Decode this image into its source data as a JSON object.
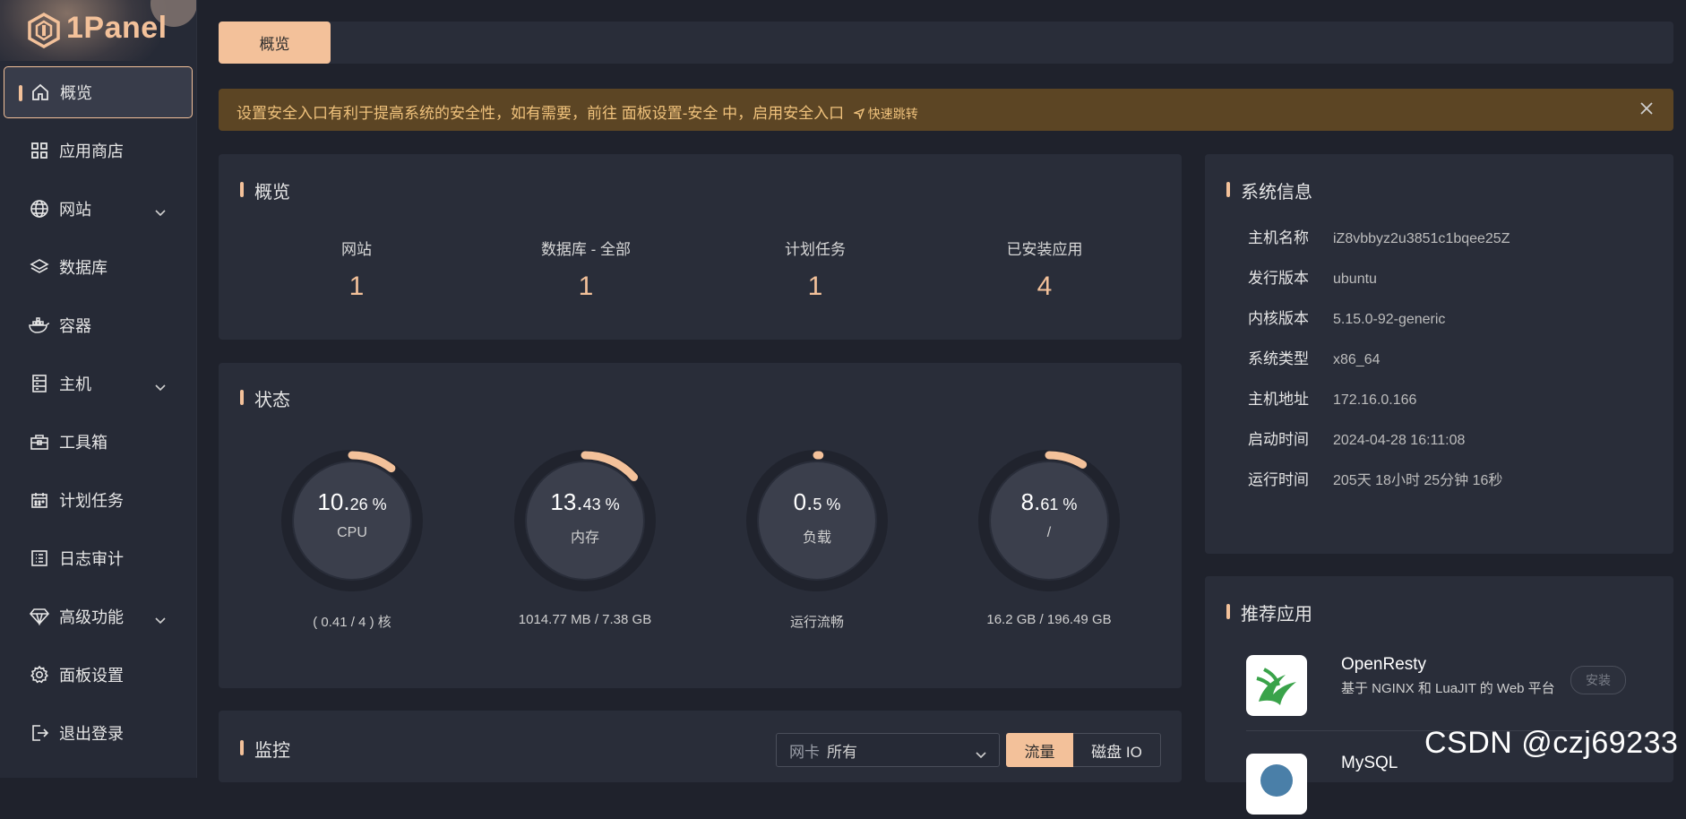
{
  "app": {
    "name": "1Panel"
  },
  "sidebar": {
    "items": [
      {
        "label": "概览",
        "icon": "home-icon",
        "active": true
      },
      {
        "label": "应用商店",
        "icon": "grid-icon"
      },
      {
        "label": "网站",
        "icon": "globe-icon",
        "expandable": true
      },
      {
        "label": "数据库",
        "icon": "layers-icon"
      },
      {
        "label": "容器",
        "icon": "docker-icon"
      },
      {
        "label": "主机",
        "icon": "server-icon",
        "expandable": true
      },
      {
        "label": "工具箱",
        "icon": "toolbox-icon"
      },
      {
        "label": "计划任务",
        "icon": "calendar-icon"
      },
      {
        "label": "日志审计",
        "icon": "log-list-icon"
      },
      {
        "label": "高级功能",
        "icon": "diamond-icon",
        "expandable": true
      },
      {
        "label": "面板设置",
        "icon": "gear-icon"
      },
      {
        "label": "退出登录",
        "icon": "logout-icon"
      }
    ]
  },
  "tabs": {
    "active_label": "概览"
  },
  "alert": {
    "message": "设置安全入口有利于提高系统的安全性，如有需要，前往 面板设置-安全 中，启用安全入口",
    "jump_label": "快速跳转"
  },
  "overview": {
    "title": "概览",
    "stats": [
      {
        "label": "网站",
        "value": "1"
      },
      {
        "label": "数据库 - 全部",
        "value": "1"
      },
      {
        "label": "计划任务",
        "value": "1"
      },
      {
        "label": "已安装应用",
        "value": "4"
      }
    ]
  },
  "status": {
    "title": "状态",
    "gauges": [
      {
        "int": "10.",
        "dec": "26 %",
        "percent": 10.26,
        "name": "CPU",
        "sub": "( 0.41 / 4 ) 核"
      },
      {
        "int": "13.",
        "dec": "43 %",
        "percent": 13.43,
        "name": "内存",
        "sub": "1014.77 MB / 7.38 GB"
      },
      {
        "int": "0.",
        "dec": "5 %",
        "percent": 0.5,
        "name": "负载",
        "sub": "运行流畅"
      },
      {
        "int": "8.",
        "dec": "61 %",
        "percent": 8.61,
        "name": "/",
        "sub": "16.2 GB / 196.49 GB"
      }
    ]
  },
  "system_info": {
    "title": "系统信息",
    "rows": [
      {
        "key": "主机名称",
        "value": "iZ8vbbyz2u3851c1bqee25Z"
      },
      {
        "key": "发行版本",
        "value": "ubuntu"
      },
      {
        "key": "内核版本",
        "value": "5.15.0-92-generic"
      },
      {
        "key": "系统类型",
        "value": "x86_64"
      },
      {
        "key": "主机地址",
        "value": "172.16.0.166"
      },
      {
        "key": "启动时间",
        "value": "2024-04-28 16:11:08"
      },
      {
        "key": "运行时间",
        "value": "205天 18小时 25分钟 16秒"
      }
    ]
  },
  "recommended": {
    "title": "推荐应用",
    "apps": [
      {
        "name": "OpenResty",
        "desc": "基于 NGINX 和 LuaJIT 的 Web 平台",
        "install_label": "安装",
        "icon": "openresty-icon"
      },
      {
        "name": "MySQL",
        "icon": "mysql-icon"
      }
    ]
  },
  "monitor": {
    "title": "监控",
    "nic_prefix": "网卡",
    "nic_value": "所有",
    "seg_traffic": "流量",
    "seg_disk": "磁盘 IO"
  },
  "watermark": "CSDN @czj69233",
  "colors": {
    "accent": "#f3c19a",
    "background": "#1f222c",
    "card": "#292d39",
    "alert_bg": "#5c4524",
    "alert_text": "#f0c27c"
  }
}
